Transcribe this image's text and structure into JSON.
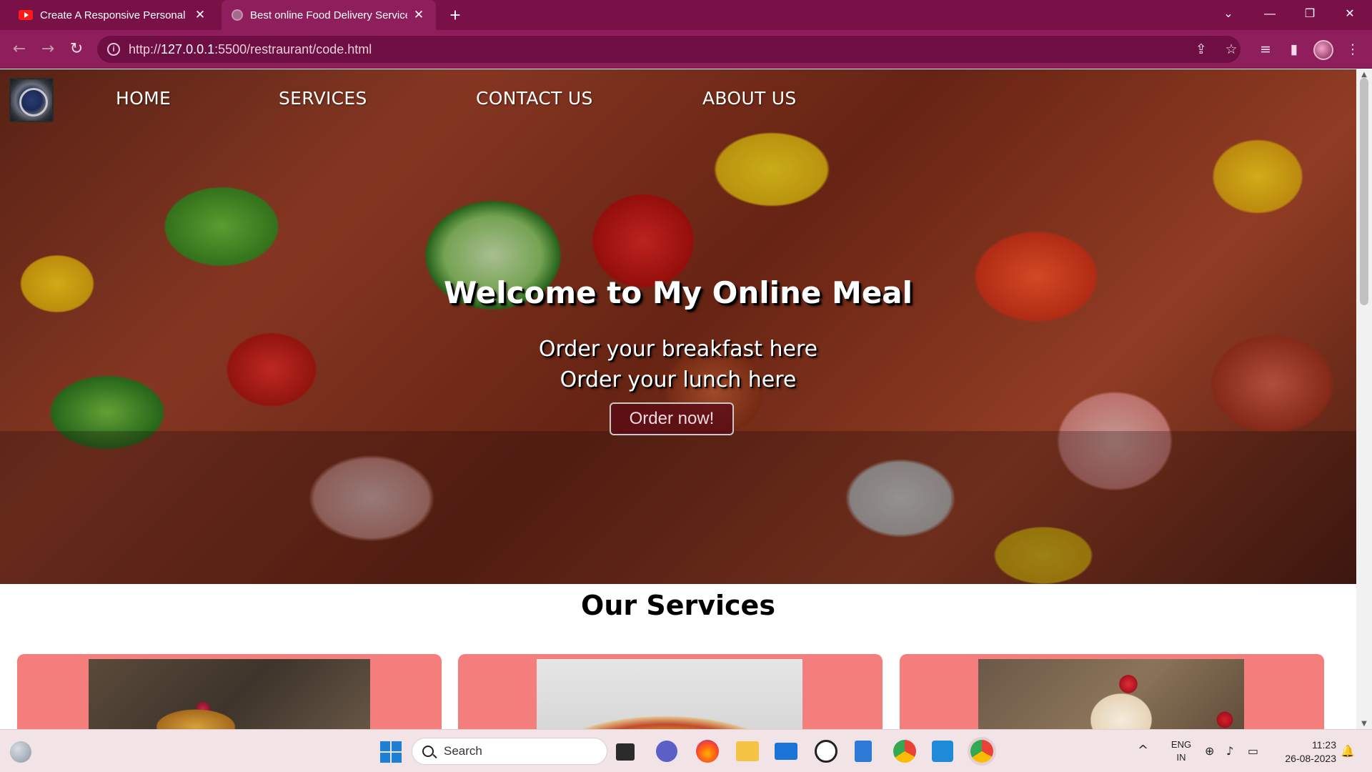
{
  "browser": {
    "tabs": [
      {
        "title": "Create A Responsive Personal PO",
        "favicon": "youtube-icon",
        "active": false
      },
      {
        "title": "Best online Food Delivery Service",
        "favicon": "globe-icon",
        "active": true
      }
    ],
    "address": {
      "prefix": "http://",
      "host": "127.0.0.1",
      "path": ":5500/restraurant/code.html"
    }
  },
  "page": {
    "nav": {
      "home": "HOME",
      "services": "SERVICES",
      "contact": "CONTACT US",
      "about": "ABOUT US"
    },
    "hero": {
      "title": "Welcome to My Online Meal",
      "line1": "Order your breakfast here",
      "line2": "Order your lunch here",
      "button": "Order now!"
    },
    "services": {
      "title": "Our Services",
      "cards": [
        {
          "image": "pancakes-photo"
        },
        {
          "image": "pizza-photo"
        },
        {
          "image": "dessert-photo"
        }
      ]
    }
  },
  "taskbar": {
    "search_placeholder": "Search",
    "lang_top": "ENG",
    "lang_bottom": "IN",
    "time": "11:23",
    "date": "26-08-2023"
  },
  "colors": {
    "tab_bar": "#7a1048",
    "toolbar": "#8e1f5c",
    "card": "#f37e7c",
    "taskbar": "#f2e4e6"
  }
}
